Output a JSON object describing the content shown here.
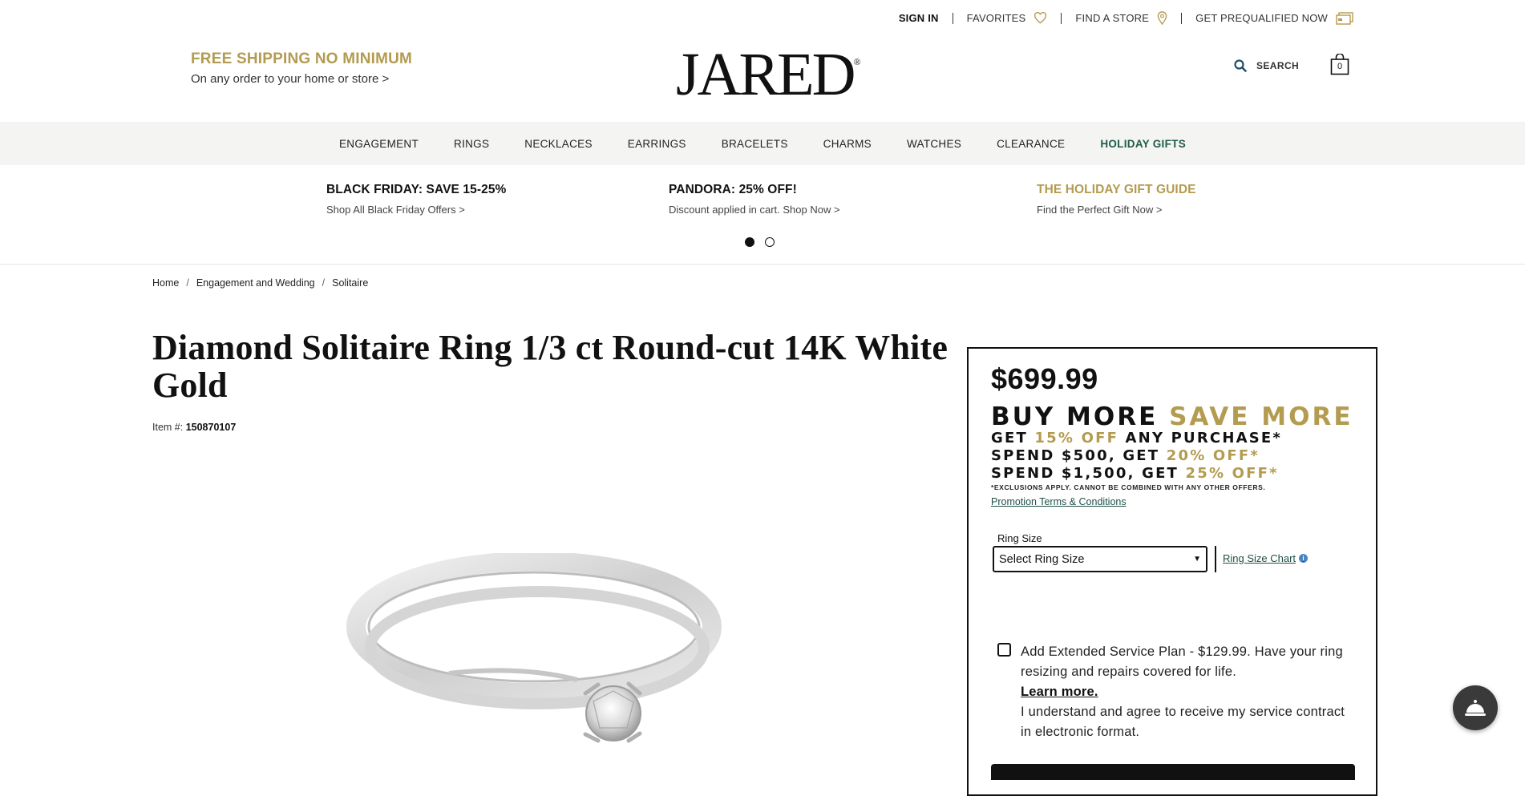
{
  "utility": {
    "sign_in": "SIGN IN",
    "favorites": "FAVORITES",
    "find_store": "FIND A STORE",
    "prequalified": "GET PREQUALIFIED NOW"
  },
  "header": {
    "promo_title": "FREE SHIPPING NO MINIMUM",
    "promo_sub": "On any order to your home or store >",
    "logo": "JARED",
    "logo_mark": "®",
    "search_label": "SEARCH",
    "bag_count": "0"
  },
  "nav": [
    "ENGAGEMENT",
    "RINGS",
    "NECKLACES",
    "EARRINGS",
    "BRACELETS",
    "CHARMS",
    "WATCHES",
    "CLEARANCE",
    "HOLIDAY GIFTS"
  ],
  "offers": [
    {
      "title": "BLACK FRIDAY: SAVE 15-25%",
      "sub": "Shop All Black Friday Offers >"
    },
    {
      "title": "PANDORA: 25% OFF!",
      "sub": "Discount applied in cart. Shop Now >"
    },
    {
      "title": "THE HOLIDAY GIFT GUIDE",
      "sub": "Find the Perfect Gift Now >"
    }
  ],
  "carousel": {
    "active_index": 0,
    "count": 2
  },
  "breadcrumb": [
    "Home",
    "Engagement and Wedding",
    "Solitaire"
  ],
  "breadcrumb_sep": "/",
  "product": {
    "title": "Diamond Solitaire Ring 1/3 ct Round-cut 14K White Gold",
    "item_label": "Item #:",
    "item_number": "150870107",
    "price": "$699.99"
  },
  "promo_block": {
    "headline_a": "BUY MORE ",
    "headline_b": "SAVE MORE",
    "line1_a": "GET ",
    "line1_b": "15% OFF",
    "line1_c": " ANY PURCHASE*",
    "line2_a": "SPEND $500, GET ",
    "line2_b": "20% OFF*",
    "line3_a": "SPEND $1,500, GET ",
    "line3_b": "25% OFF*",
    "exclusions": "*EXCLUSIONS APPLY. CANNOT BE COMBINED WITH ANY OTHER OFFERS.",
    "terms_link": "Promotion Terms & Conditions"
  },
  "ring_size": {
    "label": "Ring Size",
    "selected": "Select Ring Size",
    "chart_link": "Ring Size Chart"
  },
  "service_plan": {
    "text": "Add Extended Service Plan -  $129.99. Have your ring resizing and repairs covered for life.",
    "learn_more": "Learn more.",
    "agree": "I understand and agree to receive my service contract in electronic format.",
    "checked": false
  },
  "colors": {
    "gold": "#b39b50",
    "green": "#1f5b4c",
    "nav_bg": "#f4f4f2"
  }
}
